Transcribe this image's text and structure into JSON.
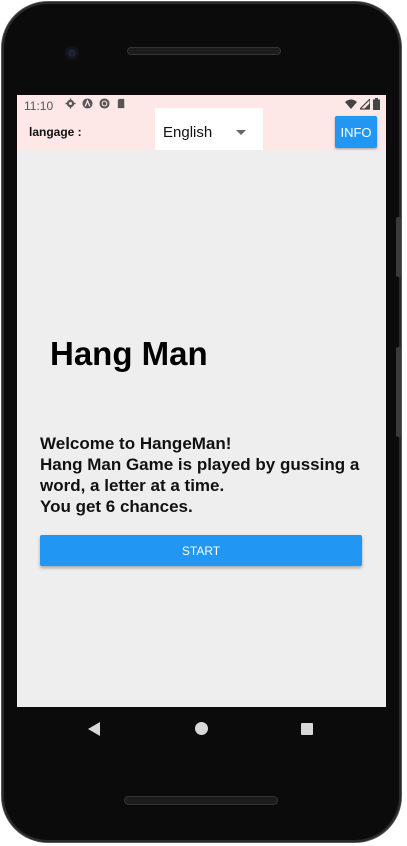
{
  "status_bar": {
    "time": "11:10",
    "icons": [
      "settings-icon",
      "app-icon",
      "sync-icon",
      "sd-card-icon",
      "wifi-icon",
      "signal-icon",
      "battery-icon"
    ]
  },
  "top_bar": {
    "language_label": "langage :",
    "language_selected": "English",
    "info_label": "INFO"
  },
  "main": {
    "title": "Hang Man",
    "description_lines": [
      "Welcome to HangeMan!",
      "Hang Man Game is played by gussing a",
      "word, a letter at a time.",
      "You get 6 chances."
    ],
    "start_label": "START"
  },
  "navigation": {
    "buttons": [
      "back",
      "home",
      "recents"
    ]
  },
  "colors": {
    "top_bar_bg": "#fde7e7",
    "accent": "#2196f3",
    "screen_bg": "#eeeeee"
  }
}
